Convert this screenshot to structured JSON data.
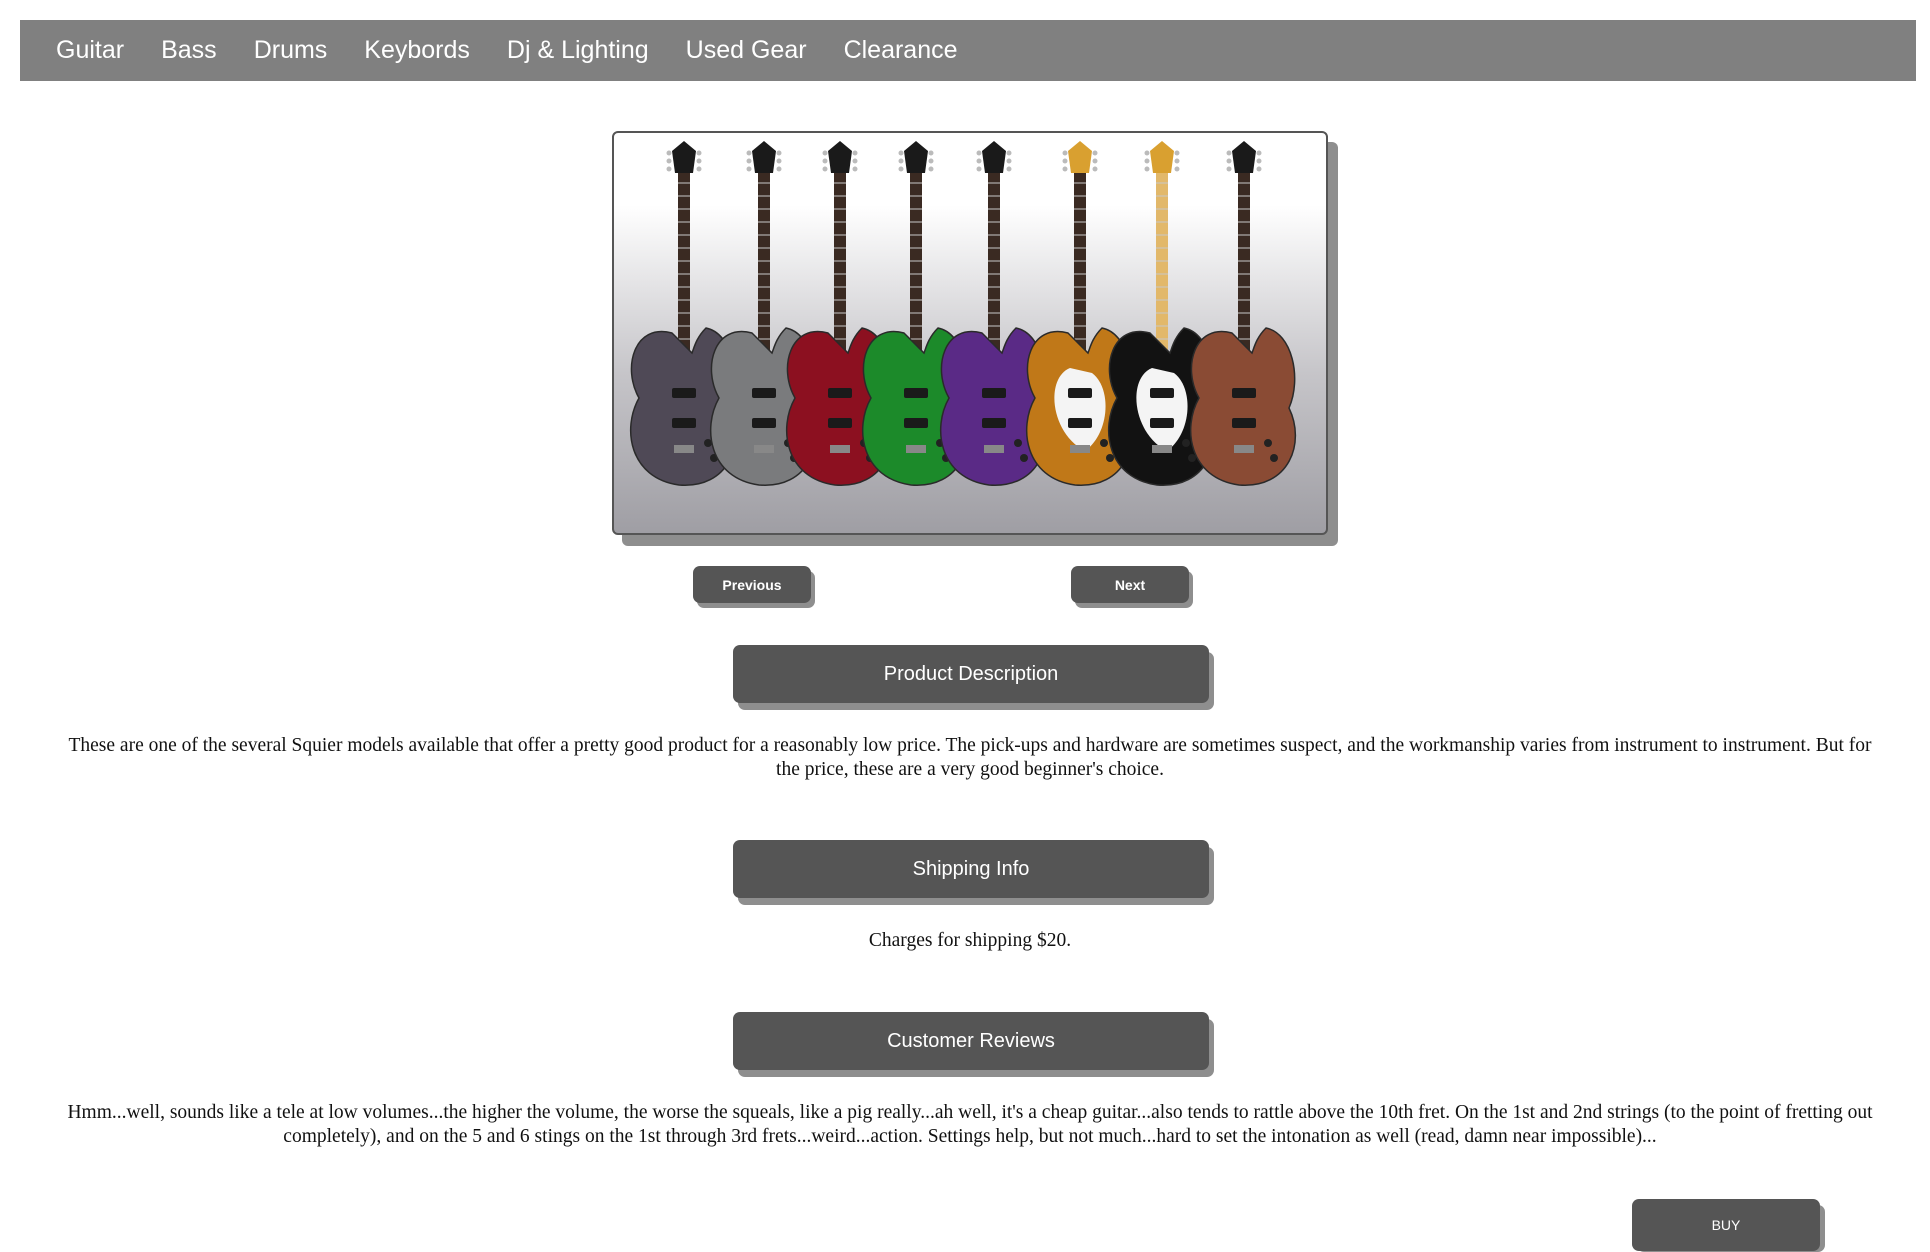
{
  "nav": {
    "items": [
      {
        "label": "Guitar"
      },
      {
        "label": "Bass"
      },
      {
        "label": "Drums"
      },
      {
        "label": "Keybords"
      },
      {
        "label": "Dj & Lighting"
      },
      {
        "label": "Used Gear"
      },
      {
        "label": "Clearance"
      }
    ]
  },
  "carousel": {
    "previous_label": "Previous",
    "next_label": "Next",
    "guitar_colors": [
      "#4f4956",
      "#7a7b7d",
      "#8c1020",
      "#1c8a2a",
      "#5a2a86",
      "#c07818",
      "#121212",
      "#8a4b34"
    ]
  },
  "product_description": {
    "heading": "Product Description",
    "text": "These are one of the several Squier models available that offer a pretty good product for a reasonably low price. The pick-ups and hardware are sometimes suspect, and the workmanship varies from instrument to instrument. But for the price, these are a very good beginner's choice."
  },
  "shipping_info": {
    "heading": "Shipping Info",
    "text": "Charges for shipping $20."
  },
  "customer_reviews": {
    "heading": "Customer Reviews",
    "text": "Hmm...well, sounds like a tele at low volumes...the higher the volume, the worse the squeals, like a pig really...ah well, it's a cheap guitar...also tends to rattle above the 10th fret. On the 1st and 2nd strings (to the point of fretting out completely), and on the 5 and 6 stings on the 1st through 3rd frets...weird...action. Settings help, but not much...hard to set the intonation as well (read, damn near impossible)..."
  },
  "buy": {
    "label": "BUY"
  }
}
